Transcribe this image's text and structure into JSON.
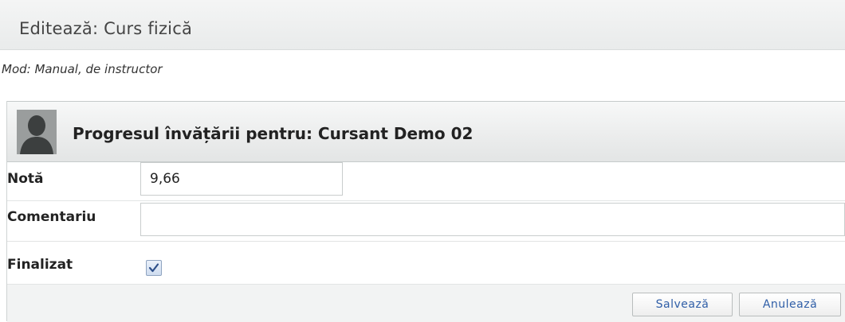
{
  "window": {
    "title": "Editează: Curs fizică",
    "mode": "Mod: Manual, de instructor"
  },
  "panel": {
    "title": "Progresul învățării pentru: Cursant Demo 02",
    "avatar_icon": "user-avatar-icon"
  },
  "form": {
    "grade_label": "Notă",
    "grade_value": "9,66",
    "comment_label": "Comentariu",
    "comment_value": "",
    "completed_label": "Finalizat",
    "completed_checked": true
  },
  "actions": {
    "save_label": "Salvează",
    "cancel_label": "Anulează"
  },
  "colors": {
    "button_text": "#2f5ea7",
    "header_bg": "#eceded"
  }
}
